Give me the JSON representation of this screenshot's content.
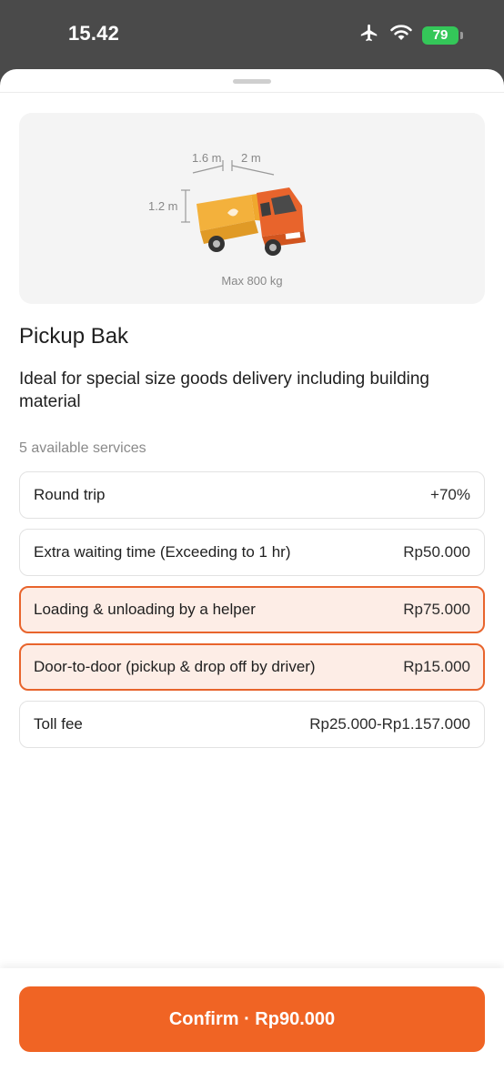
{
  "status": {
    "time": "15.42",
    "battery": "79"
  },
  "vehicle": {
    "width_label": "1.6 m",
    "length_label": "2 m",
    "height_label": "1.2 m",
    "max_load": "Max 800 kg",
    "name": "Pickup Bak",
    "description": "Ideal for special size goods delivery including building material",
    "accent_color": "#f06424"
  },
  "services": {
    "count_label": "5 available services",
    "items": [
      {
        "label": "Round trip",
        "price": "+70%",
        "selected": false
      },
      {
        "label": "Extra waiting time (Exceeding to 1 hr)",
        "price": "Rp50.000",
        "selected": false
      },
      {
        "label": "Loading & unloading by a helper",
        "price": "Rp75.000",
        "selected": true
      },
      {
        "label": "Door-to-door (pickup & drop off by driver)",
        "price": "Rp15.000",
        "selected": true
      },
      {
        "label": "Toll fee",
        "price": "Rp25.000-Rp1.157.000",
        "selected": false
      }
    ]
  },
  "confirm": {
    "label": "Confirm · Rp90.000"
  }
}
